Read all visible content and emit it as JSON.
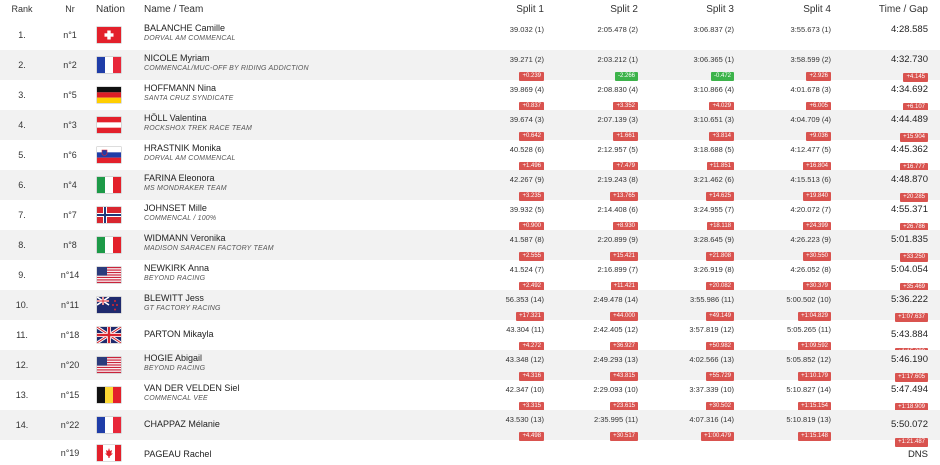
{
  "headers": {
    "rank": "Rank",
    "nr": "Nr",
    "nation": "Nation",
    "name_team": "Name / Team",
    "split1": "Split 1",
    "split2": "Split 2",
    "split3": "Split 3",
    "split4": "Split 4",
    "time_gap": "Time / Gap"
  },
  "rows": [
    {
      "rank": "1.",
      "nr": "n°1",
      "flag": "SUI",
      "name": "BALANCHE Camille",
      "team": "DORVAL AM COMMENCAL",
      "s1": "39.032 (1)",
      "g1": "",
      "s2": "2:05.478 (2)",
      "g2": "",
      "s3": "3:06.837 (2)",
      "g3": "",
      "s4": "3:55.673 (1)",
      "g4": "",
      "time": "4:28.585",
      "gap": ""
    },
    {
      "rank": "2.",
      "nr": "n°2",
      "flag": "FRA",
      "name": "NICOLE Myriam",
      "team": "COMMENCAL/MUC-OFF BY RIDING ADDICTION",
      "s1": "39.271 (2)",
      "g1": "+0.239",
      "s2": "2:03.212 (1)",
      "g2": "-2.266",
      "s3": "3:06.365 (1)",
      "g3": "-0.472",
      "s4": "3:58.599 (2)",
      "g4": "+2.926",
      "time": "4:32.730",
      "gap": "+4.145"
    },
    {
      "rank": "3.",
      "nr": "n°5",
      "flag": "GER",
      "name": "HOFFMANN Nina",
      "team": "SANTA CRUZ SYNDICATE",
      "s1": "39.869 (4)",
      "g1": "+0.837",
      "s2": "2:08.830 (4)",
      "g2": "+3.352",
      "s3": "3:10.866 (4)",
      "g3": "+4.029",
      "s4": "4:01.678 (3)",
      "g4": "+6.005",
      "time": "4:34.692",
      "gap": "+6.107"
    },
    {
      "rank": "4.",
      "nr": "n°3",
      "flag": "AUT",
      "name": "HÖLL Valentina",
      "team": "ROCKSHOX TREK RACE TEAM",
      "s1": "39.674 (3)",
      "g1": "+0.642",
      "s2": "2:07.139 (3)",
      "g2": "+1.661",
      "s3": "3:10.651 (3)",
      "g3": "+3.814",
      "s4": "4:04.709 (4)",
      "g4": "+9.036",
      "time": "4:44.489",
      "gap": "+15.904"
    },
    {
      "rank": "5.",
      "nr": "n°6",
      "flag": "SLO",
      "name": "HRASTNIK Monika",
      "team": "DORVAL AM COMMENCAL",
      "s1": "40.528 (6)",
      "g1": "+1.496",
      "s2": "2:12.957 (5)",
      "g2": "+7.479",
      "s3": "3:18.688 (5)",
      "g3": "+11.851",
      "s4": "4:12.477 (5)",
      "g4": "+16.804",
      "time": "4:45.362",
      "gap": "+16.777"
    },
    {
      "rank": "6.",
      "nr": "n°4",
      "flag": "ITA",
      "name": "FARINA Eleonora",
      "team": "MS MONDRAKER TEAM",
      "s1": "42.267 (9)",
      "g1": "+3.235",
      "s2": "2:19.243 (8)",
      "g2": "+13.765",
      "s3": "3:21.462 (6)",
      "g3": "+14.625",
      "s4": "4:15.513 (6)",
      "g4": "+19.840",
      "time": "4:48.870",
      "gap": "+20.285"
    },
    {
      "rank": "7.",
      "nr": "n°7",
      "flag": "NOR",
      "name": "JOHNSET Mille",
      "team": "COMMENCAL / 100%",
      "s1": "39.932 (5)",
      "g1": "+0.900",
      "s2": "2:14.408 (6)",
      "g2": "+8.930",
      "s3": "3:24.955 (7)",
      "g3": "+18.118",
      "s4": "4:20.072 (7)",
      "g4": "+24.399",
      "time": "4:55.371",
      "gap": "+26.786"
    },
    {
      "rank": "8.",
      "nr": "n°8",
      "flag": "ITA",
      "name": "WIDMANN Veronika",
      "team": "MADISON SARACEN FACTORY TEAM",
      "s1": "41.587 (8)",
      "g1": "+2.555",
      "s2": "2:20.899 (9)",
      "g2": "+15.421",
      "s3": "3:28.645 (9)",
      "g3": "+21.808",
      "s4": "4:26.223 (9)",
      "g4": "+30.550",
      "time": "5:01.835",
      "gap": "+33.250"
    },
    {
      "rank": "9.",
      "nr": "n°14",
      "flag": "USA",
      "name": "NEWKIRK Anna",
      "team": "BEYOND RACING",
      "s1": "41.524 (7)",
      "g1": "+2.492",
      "s2": "2:16.899 (7)",
      "g2": "+11.421",
      "s3": "3:26.919 (8)",
      "g3": "+20.082",
      "s4": "4:26.052 (8)",
      "g4": "+30.379",
      "time": "5:04.054",
      "gap": "+35.469"
    },
    {
      "rank": "10.",
      "nr": "n°11",
      "flag": "NZL",
      "name": "BLEWITT Jess",
      "team": "GT FACTORY RACING",
      "s1": "56.353 (14)",
      "g1": "+17.321",
      "s2": "2:49.478 (14)",
      "g2": "+44.000",
      "s3": "3:55.986 (11)",
      "g3": "+49.149",
      "s4": "5:00.502 (10)",
      "g4": "+1:04.829",
      "time": "5:36.222",
      "gap": "+1:07.637"
    },
    {
      "rank": "11.",
      "nr": "n°18",
      "flag": "GBR",
      "name": "PARTON Mikayla",
      "team": "",
      "s1": "43.304 (11)",
      "g1": "+4.272",
      "s2": "2:42.405 (12)",
      "g2": "+36.927",
      "s3": "3:57.819 (12)",
      "g3": "+50.982",
      "s4": "5:05.265 (11)",
      "g4": "+1:09.592",
      "time": "5:43.884",
      "gap": "+1:15.299"
    },
    {
      "rank": "12.",
      "nr": "n°20",
      "flag": "USA",
      "name": "HOGIE Abigail",
      "team": "BEYOND RACING",
      "s1": "43.348 (12)",
      "g1": "+4.316",
      "s2": "2:49.293 (13)",
      "g2": "+43.815",
      "s3": "4:02.566 (13)",
      "g3": "+55.729",
      "s4": "5:05.852 (12)",
      "g4": "+1:10.179",
      "time": "5:46.190",
      "gap": "+1:17.605"
    },
    {
      "rank": "13.",
      "nr": "n°15",
      "flag": "BEL",
      "name": "VAN DER VELDEN Siel",
      "team": "COMMENCAL VEE",
      "s1": "42.347 (10)",
      "g1": "+3.315",
      "s2": "2:29.093 (10)",
      "g2": "+23.615",
      "s3": "3:37.339 (10)",
      "g3": "+30.502",
      "s4": "5:10.827 (14)",
      "g4": "+1:15.154",
      "time": "5:47.494",
      "gap": "+1:18.909"
    },
    {
      "rank": "14.",
      "nr": "n°22",
      "flag": "FRA",
      "name": "CHAPPAZ Mélanie",
      "team": "",
      "s1": "43.530 (13)",
      "g1": "+4.498",
      "s2": "2:35.995 (11)",
      "g2": "+30.517",
      "s3": "4:07.316 (14)",
      "g3": "+1:00.479",
      "s4": "5:10.819 (13)",
      "g4": "+1:15.148",
      "time": "5:50.072",
      "gap": "+1:21.487"
    },
    {
      "rank": "",
      "nr": "n°19",
      "flag": "CAN",
      "name": "PAGEAU Rachel",
      "team": "",
      "s1": "",
      "g1": "",
      "s2": "",
      "g2": "",
      "s3": "",
      "g3": "",
      "s4": "",
      "g4": "",
      "time": "DNS",
      "gap": ""
    }
  ]
}
